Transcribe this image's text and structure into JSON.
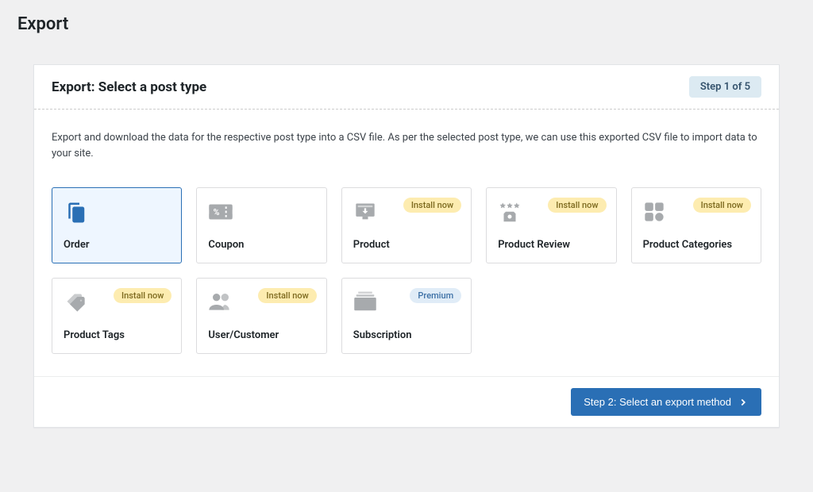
{
  "page": {
    "title": "Export"
  },
  "panel": {
    "heading": "Export: Select a post type",
    "step_badge": "Step 1 of 5",
    "intro": "Export and download the data for the respective post type into a CSV file. As per the selected post type, we can use this exported CSV file to import data to your site."
  },
  "tiles": {
    "0": {
      "label": "Order",
      "badge": null
    },
    "1": {
      "label": "Coupon",
      "badge": null
    },
    "2": {
      "label": "Product",
      "badge": "Install now"
    },
    "3": {
      "label": "Product Review",
      "badge": "Install now"
    },
    "4": {
      "label": "Product Categories",
      "badge": "Install now"
    },
    "5": {
      "label": "Product Tags",
      "badge": "Install now"
    },
    "6": {
      "label": "User/Customer",
      "badge": "Install now"
    },
    "7": {
      "label": "Subscription",
      "badge": "Premium"
    }
  },
  "footer": {
    "next_label": "Step 2: Select an export method"
  }
}
